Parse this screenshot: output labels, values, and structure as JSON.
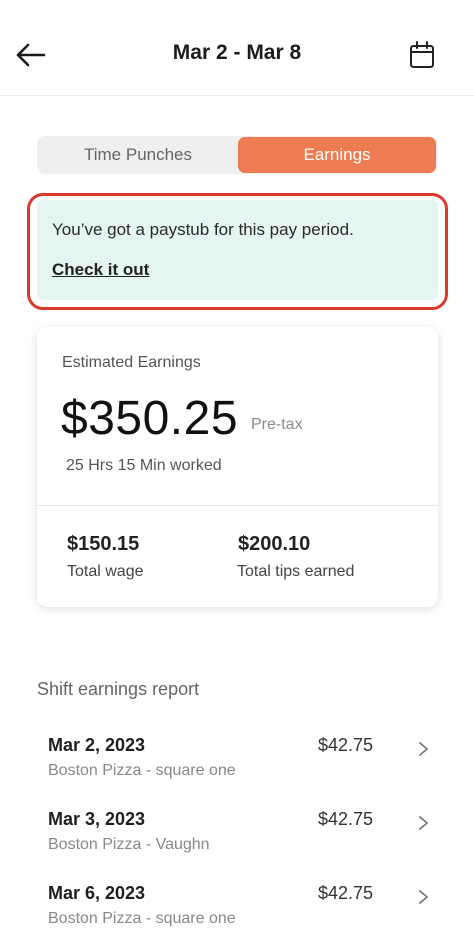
{
  "header": {
    "title": "Mar 2 - Mar 8",
    "back_icon": "arrow-left-icon",
    "calendar_icon": "calendar-icon"
  },
  "tabs": [
    {
      "label": "Time Punches",
      "active": false
    },
    {
      "label": "Earnings",
      "active": true
    }
  ],
  "notice": {
    "text": "You’ve got a paystub for this pay period.",
    "link": "Check it out"
  },
  "earnings": {
    "label": "Estimated Earnings",
    "amount": "$350.25",
    "pretax": "Pre-tax",
    "worked": "25 Hrs 15 Min worked",
    "total_wage_value": "$150.15",
    "total_wage_label": "Total wage",
    "total_tips_value": "$200.10",
    "total_tips_label": "Total tips earned"
  },
  "report": {
    "title": "Shift earnings report",
    "shifts": [
      {
        "date": "Mar 2, 2023",
        "location": "Boston Pizza - square one",
        "amount": "$42.75"
      },
      {
        "date": "Mar 3, 2023",
        "location": "Boston Pizza - Vaughn",
        "amount": "$42.75"
      },
      {
        "date": "Mar 6, 2023",
        "location": "Boston Pizza - square one",
        "amount": "$42.75"
      }
    ]
  },
  "colors": {
    "accent": "#ed7c52",
    "highlight_outline": "#d93a2b",
    "notice_bg": "#e5f5f1"
  }
}
